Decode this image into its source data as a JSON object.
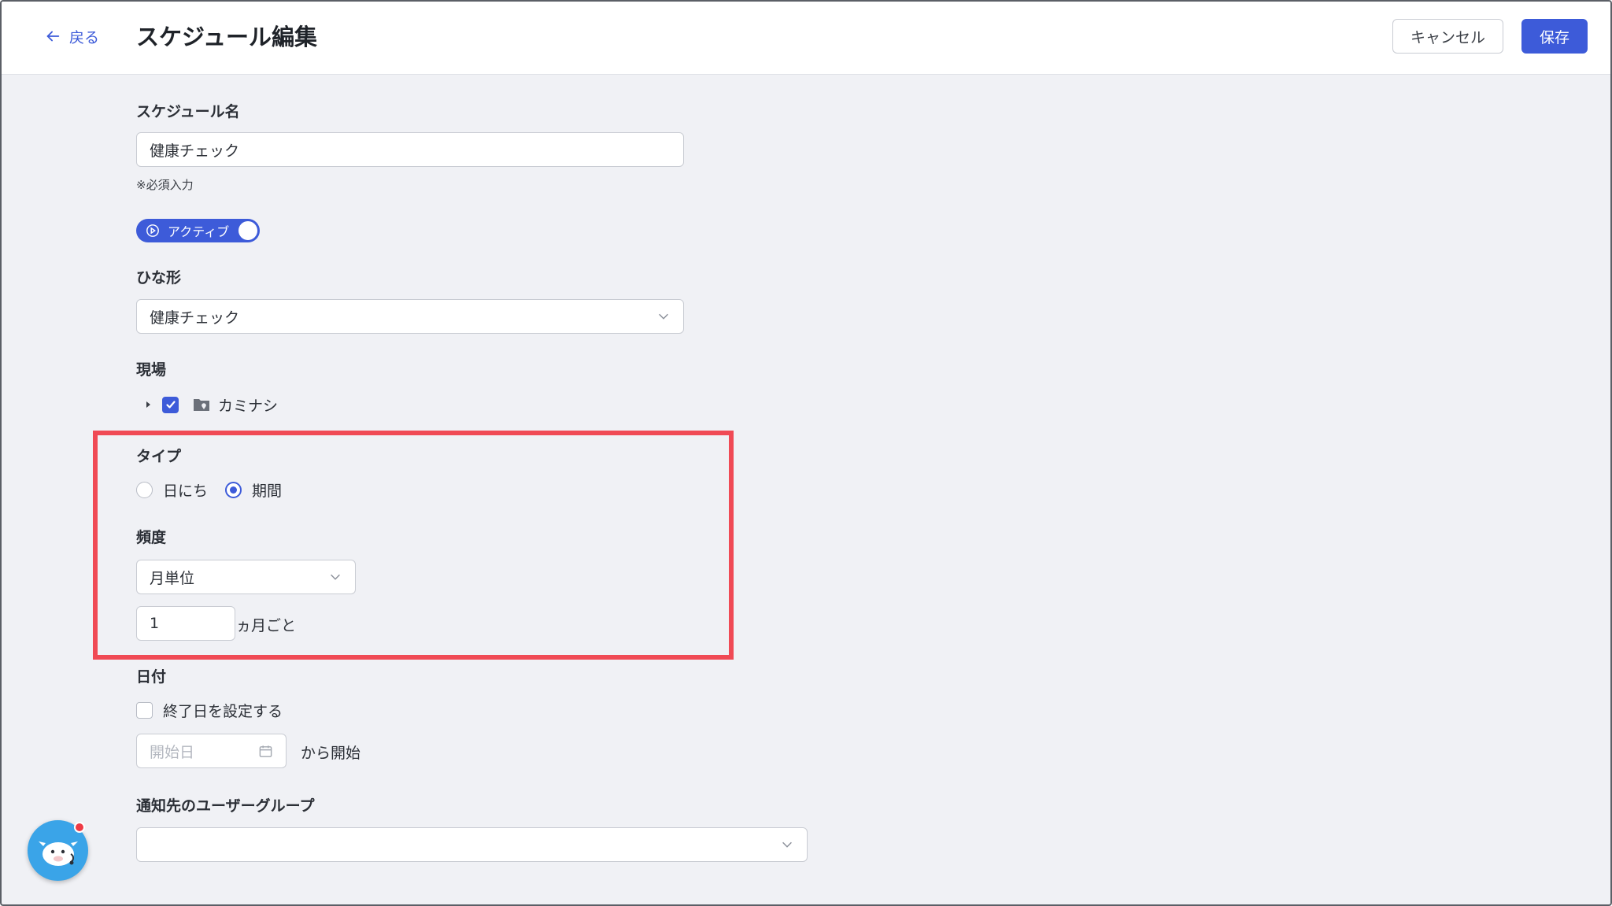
{
  "header": {
    "back_label": "戻る",
    "title": "スケジュール編集",
    "cancel_label": "キャンセル",
    "save_label": "保存"
  },
  "form": {
    "name": {
      "label": "スケジュール名",
      "value": "健康チェック",
      "hint": "※必須入力"
    },
    "status_toggle": {
      "label": "アクティブ",
      "on": true
    },
    "template": {
      "label": "ひな形",
      "value": "健康チェック"
    },
    "site": {
      "label": "現場",
      "items": [
        {
          "label": "カミナシ",
          "checked": true
        }
      ]
    },
    "type": {
      "label": "タイプ",
      "options": [
        {
          "label": "日にち",
          "selected": false
        },
        {
          "label": "期間",
          "selected": true
        }
      ]
    },
    "frequency": {
      "label": "頻度",
      "value": "月単位",
      "interval_value": "1",
      "interval_suffix": "ヵ月ごと"
    },
    "date": {
      "label": "日付",
      "end_date_checkbox_label": "終了日を設定する",
      "end_date_checked": false,
      "start_placeholder": "開始日",
      "start_suffix": "から開始"
    },
    "notify_group": {
      "label": "通知先のユーザーグループ",
      "value": ""
    }
  },
  "colors": {
    "accent": "#3d5bd9",
    "highlight": "#f04a55",
    "background": "#f0f1f5"
  }
}
